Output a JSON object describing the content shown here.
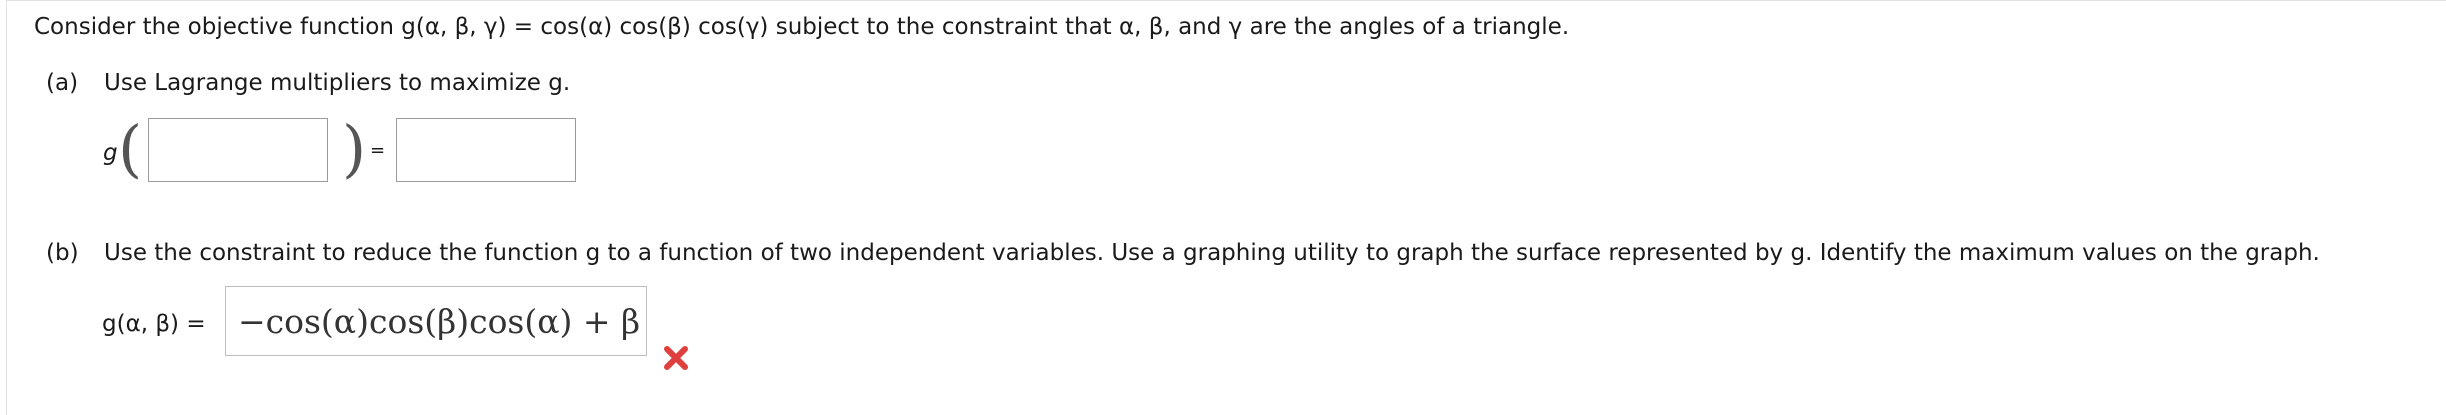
{
  "problem": {
    "statement": "Consider the objective function g(α, β, γ) = cos(α) cos(β) cos(γ) subject to the constraint that α, β, and γ are the angles of a triangle."
  },
  "part_a": {
    "label": "(a)",
    "instruction": "Use Lagrange multipliers to maximize g.",
    "func_name": "g",
    "equals": "=",
    "point_input_value": "",
    "value_input_value": ""
  },
  "part_b": {
    "label": "(b)",
    "instruction": "Use the constraint to reduce the function g to a function of two independent variables. Use a graphing utility to graph the surface represented by g. Identify the maximum values on the graph.",
    "answer_label": "g(α, β) =",
    "answer_value": "−cos(α)cos(β)cos(α) + β",
    "status": "incorrect"
  },
  "colors": {
    "incorrect_icon": "#e0403d",
    "input_border": "#9b9b9b"
  }
}
